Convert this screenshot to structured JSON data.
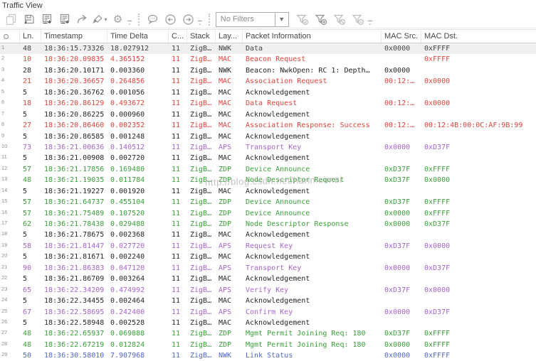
{
  "title": "Traffic View",
  "toolbar": {
    "icon_names": [
      "copy-icon",
      "save-icon",
      "export-log-icon",
      "export-packets-icon",
      "share-icon",
      "brush-icon",
      "brush-dropdown-caret",
      "settings-icon",
      "comments-icon",
      "previous-icon",
      "next-icon",
      "filter-apply-icon",
      "filter-add-icon",
      "filter-clear-icon",
      "filter-remove-icon"
    ],
    "filter": {
      "value": "No Filters"
    }
  },
  "watermark": "http://blog.csdn.net/harimeimei",
  "colors": {
    "dark": "#454545",
    "black": "#262626",
    "red": "#e0443c",
    "green": "#3a9e3a",
    "purple": "#a465c9",
    "blue": "#5068c8",
    "gutter": "#8f8f8f",
    "selected_bg": "#efefef"
  },
  "table": {
    "columns": [
      "",
      "Ln.",
      "Timestamp",
      "Time Delta",
      "C...",
      "Stack",
      "Lay...",
      "Packet Information",
      "MAC Src.",
      "MAC Dst."
    ],
    "row_fields": [
      "num",
      "ln",
      "timestamp",
      "time_delta",
      "channel",
      "stack",
      "layer",
      "info",
      "mac_src",
      "mac_dst",
      "color",
      "selected"
    ],
    "rows": [
      [
        1,
        "48",
        "18:36:15.73326",
        "18.027912",
        "11",
        "ZigB…",
        "NWK",
        "Data",
        "0x0000",
        "0xFFFF",
        "dark",
        true
      ],
      [
        2,
        "10",
        "18:36:20.09835",
        "4.365152",
        "11",
        "ZigB…",
        "MAC",
        "Beacon Request",
        "",
        "0xFFFF",
        "red",
        false
      ],
      [
        3,
        "28",
        "18:36:20.10171",
        "0.003360",
        "11",
        "ZigB…",
        "NWK",
        "Beacon: NwkOpen: RC 1: Depth…",
        "0x0000",
        "",
        "black",
        false
      ],
      [
        4,
        "21",
        "18:36:20.36657",
        "0.264856",
        "11",
        "ZigB…",
        "MAC",
        "Association Request",
        "00:12:…",
        "0x0000",
        "red",
        false
      ],
      [
        5,
        "5",
        "18:36:20.36762",
        "0.001056",
        "11",
        "ZigB…",
        "MAC",
        "Acknowledgement",
        "",
        "",
        "black",
        false
      ],
      [
        6,
        "18",
        "18:36:20.86129",
        "0.493672",
        "11",
        "ZigB…",
        "MAC",
        "Data Request",
        "00:12:…",
        "0x0000",
        "red",
        false
      ],
      [
        7,
        "5",
        "18:36:20.86225",
        "0.000960",
        "11",
        "ZigB…",
        "MAC",
        "Acknowledgement",
        "",
        "",
        "black",
        false
      ],
      [
        8,
        "27",
        "18:36:20.86460",
        "0.002352",
        "11",
        "ZigB…",
        "MAC",
        "Association Response: Success",
        "00:12:…",
        "00:12:4B:00:0C:AF:9B:99",
        "red",
        false
      ],
      [
        9,
        "5",
        "18:36:20.86585",
        "0.001248",
        "11",
        "ZigB…",
        "MAC",
        "Acknowledgement",
        "",
        "",
        "black",
        false
      ],
      [
        10,
        "73",
        "18:36:21.00636",
        "0.140512",
        "11",
        "ZigB…",
        "APS",
        "Transport Key",
        "0x0000",
        "0xD37F",
        "purple",
        false
      ],
      [
        11,
        "5",
        "18:36:21.00908",
        "0.002720",
        "11",
        "ZigB…",
        "MAC",
        "Acknowledgement",
        "",
        "",
        "black",
        false
      ],
      [
        12,
        "57",
        "18:36:21.17856",
        "0.169480",
        "11",
        "ZigB…",
        "ZDP",
        "Device Announce",
        "0xD37F",
        "0xFFFF",
        "green",
        false
      ],
      [
        13,
        "48",
        "18:36:21.19035",
        "0.011784",
        "11",
        "ZigB…",
        "ZDP",
        "Node Descriptor Request",
        "0xD37F",
        "0x0000",
        "green",
        false
      ],
      [
        14,
        "5",
        "18:36:21.19227",
        "0.001920",
        "11",
        "ZigB…",
        "MAC",
        "Acknowledgement",
        "",
        "",
        "black",
        false
      ],
      [
        15,
        "57",
        "18:36:21.64737",
        "0.455104",
        "11",
        "ZigB…",
        "ZDP",
        "Device Announce",
        "0xD37F",
        "0xFFFF",
        "green",
        false
      ],
      [
        16,
        "57",
        "18:36:21.75489",
        "0.107520",
        "11",
        "ZigB…",
        "ZDP",
        "Device Announce",
        "0x0000",
        "0xFFFF",
        "green",
        false
      ],
      [
        17,
        "62",
        "18:36:21.78438",
        "0.029488",
        "11",
        "ZigB…",
        "ZDP",
        "Node Descriptor Response",
        "0x0000",
        "0xD37F",
        "green",
        false
      ],
      [
        18,
        "5",
        "18:36:21.78675",
        "0.002368",
        "11",
        "ZigB…",
        "MAC",
        "Acknowledgement",
        "",
        "",
        "black",
        false
      ],
      [
        19,
        "58",
        "18:36:21.81447",
        "0.027720",
        "11",
        "ZigB…",
        "APS",
        "Request Key",
        "0xD37F",
        "0x0000",
        "purple",
        false
      ],
      [
        20,
        "5",
        "18:36:21.81671",
        "0.002240",
        "11",
        "ZigB…",
        "MAC",
        "Acknowledgement",
        "",
        "",
        "black",
        false
      ],
      [
        21,
        "90",
        "18:36:21.86383",
        "0.047120",
        "11",
        "ZigB…",
        "APS",
        "Transport Key",
        "0x0000",
        "0xD37F",
        "purple",
        false
      ],
      [
        22,
        "5",
        "18:36:21.86709",
        "0.003264",
        "11",
        "ZigB…",
        "MAC",
        "Acknowledgement",
        "",
        "",
        "black",
        false
      ],
      [
        23,
        "65",
        "18:36:22.34209",
        "0.474992",
        "11",
        "ZigB…",
        "APS",
        "Verify Key",
        "0xD37F",
        "0x0000",
        "purple",
        false
      ],
      [
        24,
        "5",
        "18:36:22.34455",
        "0.002464",
        "11",
        "ZigB…",
        "MAC",
        "Acknowledgement",
        "",
        "",
        "black",
        false
      ],
      [
        25,
        "67",
        "18:36:22.58695",
        "0.242400",
        "11",
        "ZigB…",
        "APS",
        "Confirm Key",
        "0x0000",
        "0xD37F",
        "purple",
        false
      ],
      [
        26,
        "5",
        "18:36:22.58948",
        "0.002528",
        "11",
        "ZigB…",
        "MAC",
        "Acknowledgement",
        "",
        "",
        "black",
        false
      ],
      [
        27,
        "48",
        "18:36:22.65937",
        "0.069888",
        "11",
        "ZigB…",
        "ZDP",
        "Mgmt Permit Joining Req: 180",
        "0xD37F",
        "0xFFFF",
        "green",
        false
      ],
      [
        28,
        "48",
        "18:36:22.67219",
        "0.012824",
        "11",
        "ZigB…",
        "ZDP",
        "Mgmt Permit Joining Req: 180",
        "0x0000",
        "0xFFFF",
        "green",
        false
      ],
      [
        29,
        "50",
        "18:36:30.58010",
        "7.907968",
        "11",
        "ZigB…",
        "NWK",
        "Link Status",
        "0x0000",
        "0xFFFF",
        "blue",
        false
      ]
    ]
  }
}
